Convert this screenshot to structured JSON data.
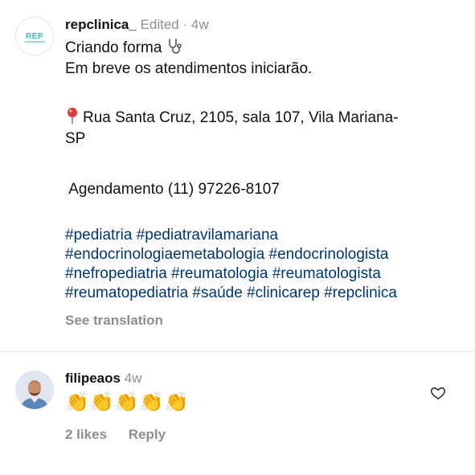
{
  "caption": {
    "username": "repclinica_",
    "edited_label": "Edited",
    "separator": "·",
    "time_ago": "4w",
    "logo_text": "REP",
    "line1": "Criando forma",
    "line2": "Em breve os atendimentos iniciarão.",
    "address_line1": "Rua Santa Cruz, 2105, sala 107, Vila Mariana-",
    "address_line2": "SP",
    "booking": " Agendamento (11) 97226-8107",
    "hashtag_lines": [
      "#pediatria #pediatravilamariana",
      "#endocrinologiaemetabologia #endocrinologista",
      "#nefropediatria #reumatologia #reumatologista",
      "#reumatopediatria #saúde #clinicarep #repclinica"
    ],
    "see_translation": "See translation"
  },
  "comment": {
    "username": "filipeaos",
    "time_ago": "4w",
    "text": "👏👏👏👏👏",
    "likes_label": "2 likes",
    "reply_label": "Reply"
  },
  "icons": {
    "pin": "location-pin-icon",
    "stethoscope": "stethoscope-icon",
    "heart": "heart-outline-icon"
  },
  "colors": {
    "hashtag": "#00376b",
    "muted": "#8e8e8e",
    "pin_red": "#d93a3a",
    "logo_teal": "#3fb6c8"
  }
}
